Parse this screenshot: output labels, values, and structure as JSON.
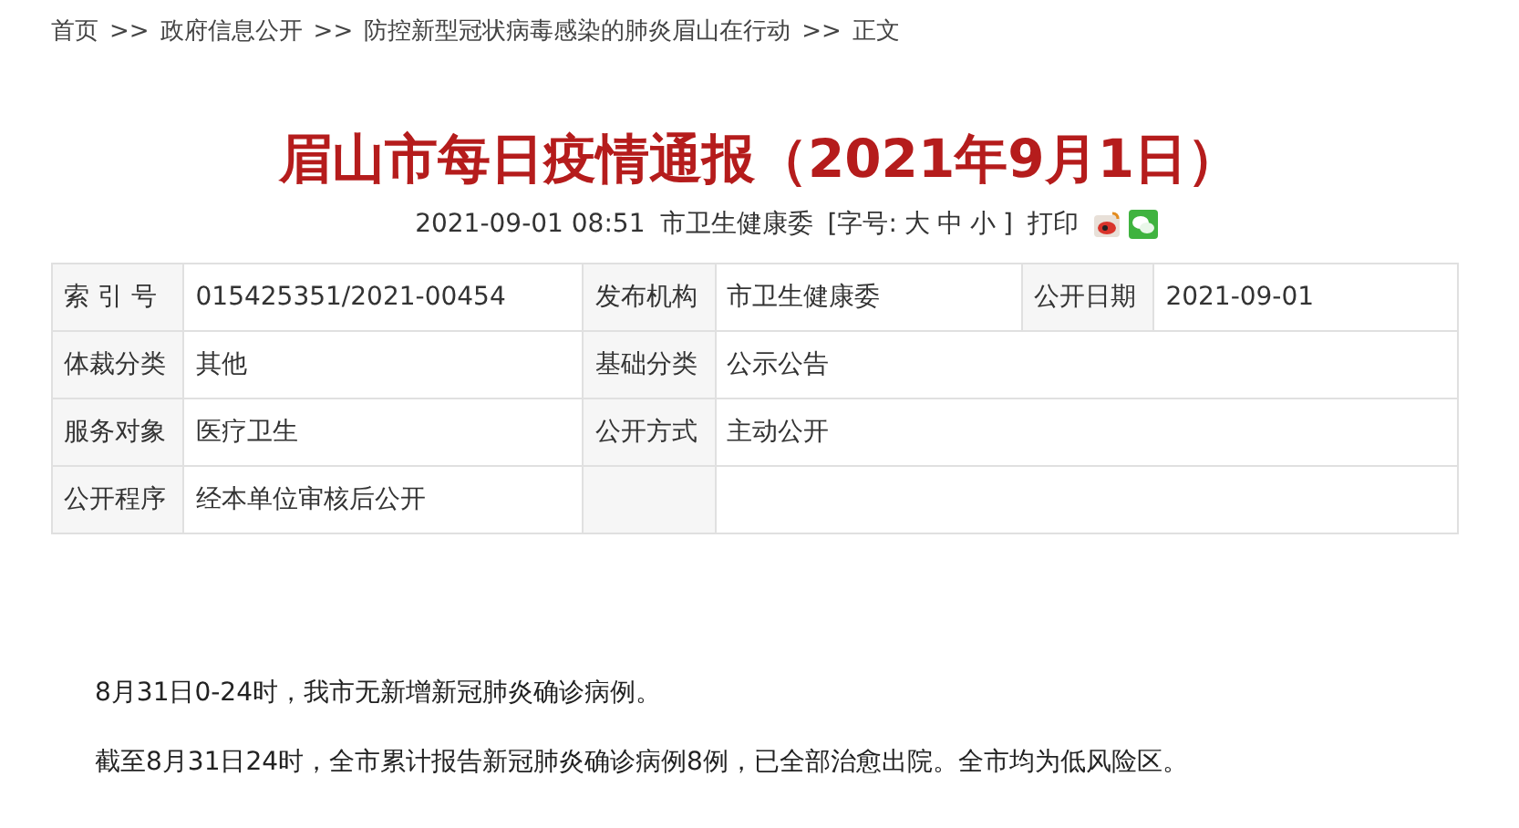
{
  "breadcrumb": [
    "首页",
    "政府信息公开",
    "防控新型冠状病毒感染的肺炎眉山在行动",
    "正文"
  ],
  "breadcrumb_separator": ">>",
  "article": {
    "title": "眉山市每日疫情通报（2021年9月1日）",
    "meta": {
      "datetime": "2021-09-01 08:51",
      "source": "市卫生健康委",
      "font_size_label": "[字号:",
      "font_sizes": [
        "大",
        "中",
        "小"
      ],
      "font_size_end": "]",
      "print": "打印"
    }
  },
  "info_table": {
    "rows": [
      [
        {
          "kind": "label",
          "text": "索 引 号"
        },
        {
          "kind": "value",
          "text": "015425351/2021-00454"
        },
        {
          "kind": "label",
          "text": "发布机构"
        },
        {
          "kind": "value",
          "text": "市卫生健康委"
        },
        {
          "kind": "label",
          "text": "公开日期"
        },
        {
          "kind": "value",
          "text": "2021-09-01"
        }
      ],
      [
        {
          "kind": "label",
          "text": "体裁分类"
        },
        {
          "kind": "value",
          "text": "其他"
        },
        {
          "kind": "label",
          "text": "基础分类"
        },
        {
          "kind": "wide",
          "colspan": 3,
          "text": "公示公告"
        }
      ],
      [
        {
          "kind": "label",
          "text": "服务对象"
        },
        {
          "kind": "value",
          "text": "医疗卫生"
        },
        {
          "kind": "label",
          "text": "公开方式"
        },
        {
          "kind": "wide",
          "colspan": 3,
          "text": "主动公开"
        }
      ],
      [
        {
          "kind": "label",
          "text": "公开程序"
        },
        {
          "kind": "value",
          "text": "经本单位审核后公开"
        },
        {
          "kind": "label"
        },
        {
          "kind": "wide",
          "colspan": 3
        }
      ]
    ]
  },
  "body": [
    "8月31日0-24时，我市无新增新冠肺炎确诊病例。",
    "截至8月31日24时，全市累计报告新冠肺炎确诊病例8例，已全部治愈出院。全市均为低风险区。"
  ]
}
